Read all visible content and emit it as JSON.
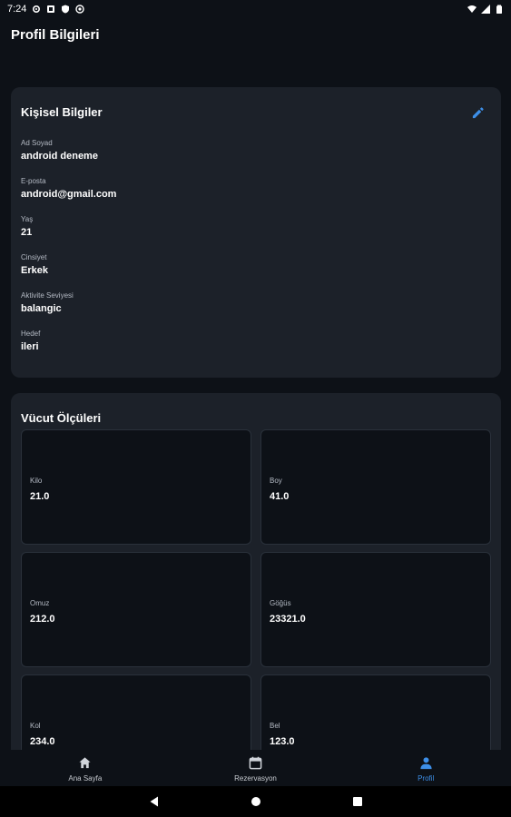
{
  "status_bar": {
    "time": "7:24"
  },
  "header": {
    "title": "Profil Bilgileri"
  },
  "personal": {
    "title": "Kişisel Bilgiler",
    "fields": [
      {
        "label": "Ad Soyad",
        "value": "android deneme"
      },
      {
        "label": "E-posta",
        "value": "android@gmail.com"
      },
      {
        "label": "Yaş",
        "value": "21"
      },
      {
        "label": "Cinsiyet",
        "value": "Erkek"
      },
      {
        "label": "Aktivite Seviyesi",
        "value": "balangic"
      },
      {
        "label": "Hedef",
        "value": "ileri"
      }
    ]
  },
  "body": {
    "title": "Vücut Ölçüleri",
    "measurements": [
      {
        "label": "Kilo",
        "value": "21.0"
      },
      {
        "label": "Boy",
        "value": "41.0"
      },
      {
        "label": "Omuz",
        "value": "212.0"
      },
      {
        "label": "Göğüs",
        "value": "23321.0"
      },
      {
        "label": "Kol",
        "value": "234.0"
      },
      {
        "label": "Bel",
        "value": "123.0"
      }
    ]
  },
  "bottom_nav": {
    "items": [
      {
        "label": "Ana Sayfa",
        "icon": "home-icon"
      },
      {
        "label": "Rezervasyon",
        "icon": "calendar-icon"
      },
      {
        "label": "Profil",
        "icon": "person-icon"
      }
    ]
  },
  "colors": {
    "accent": "#3d8fe8",
    "background": "#0d1117",
    "card": "#1c2129"
  }
}
